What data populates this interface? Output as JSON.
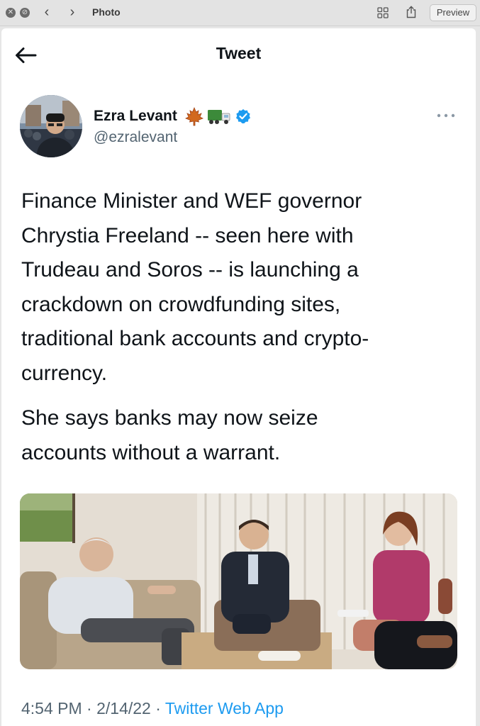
{
  "window": {
    "title": "Photo",
    "preview_label": "Preview",
    "close_glyph": "✕",
    "minimize_glyph": "⊘",
    "back_glyph": "‹",
    "forward_glyph": "›"
  },
  "tweet_header": {
    "title": "Tweet"
  },
  "author": {
    "display_name": "Ezra Levant",
    "handle": "@ezralevant",
    "badges": [
      "maple-leaf-icon",
      "truck-icon",
      "verified-badge-icon"
    ]
  },
  "tweet": {
    "paragraph1": "Finance Minister and WEF governor\nChrystia Freeland -- seen here with\nTrudeau and Soros -- is launching a\ncrackdown on crowdfunding sites,\ntraditional bank accounts and crypto-\ncurrency.",
    "paragraph2": "She says banks may now seize\naccounts without a warrant.",
    "timestamp": "4:54 PM · 2/14/22 · ",
    "source": "Twitter Web App"
  },
  "colors": {
    "link": "#1d9bf0",
    "text": "#0f1419",
    "secondary": "#536471"
  }
}
